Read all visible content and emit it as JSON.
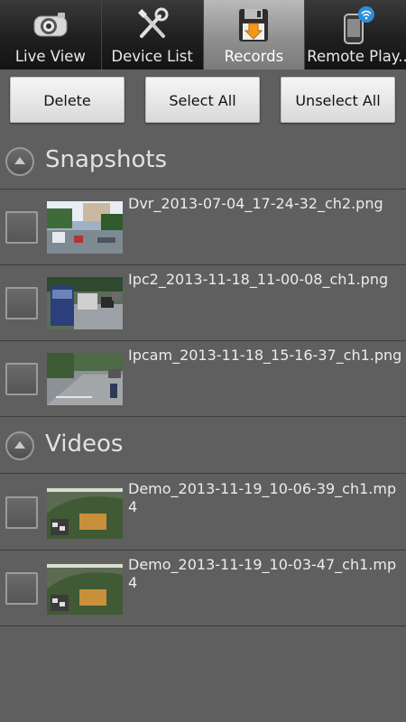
{
  "tabs": [
    {
      "label": "Live View",
      "icon": "camera-icon",
      "active": false
    },
    {
      "label": "Device List",
      "icon": "tools-icon",
      "active": false
    },
    {
      "label": "Records",
      "icon": "floppy-download-icon",
      "active": true
    },
    {
      "label": "Remote Play..",
      "icon": "phone-wifi-icon",
      "active": false
    }
  ],
  "actions": {
    "delete": "Delete",
    "select_all": "Select All",
    "unselect_all": "Unselect All"
  },
  "sections": {
    "snapshots": {
      "title": "Snapshots",
      "items": [
        {
          "filename": "Dvr_2013-07-04_17-24-32_ch2.png",
          "thumb": "street-scene"
        },
        {
          "filename": "Ipc2_2013-11-18_11-00-08_ch1.png",
          "thumb": "traffic-truck"
        },
        {
          "filename": "Ipcam_2013-11-18_15-16-37_ch1.png",
          "thumb": "road-motorbike"
        }
      ]
    },
    "videos": {
      "title": "Videos",
      "items": [
        {
          "filename": "Demo_2013-11-19_10-06-39_ch1.mp4",
          "thumb": "demo-garden"
        },
        {
          "filename": "Demo_2013-11-19_10-03-47_ch1.mp4",
          "thumb": "demo-garden"
        }
      ]
    }
  },
  "colors": {
    "background": "#5f5f5f",
    "tab_active": "#a3a3a3",
    "tab_inactive": "#1f1f1f",
    "button": "#e8e8e8"
  }
}
